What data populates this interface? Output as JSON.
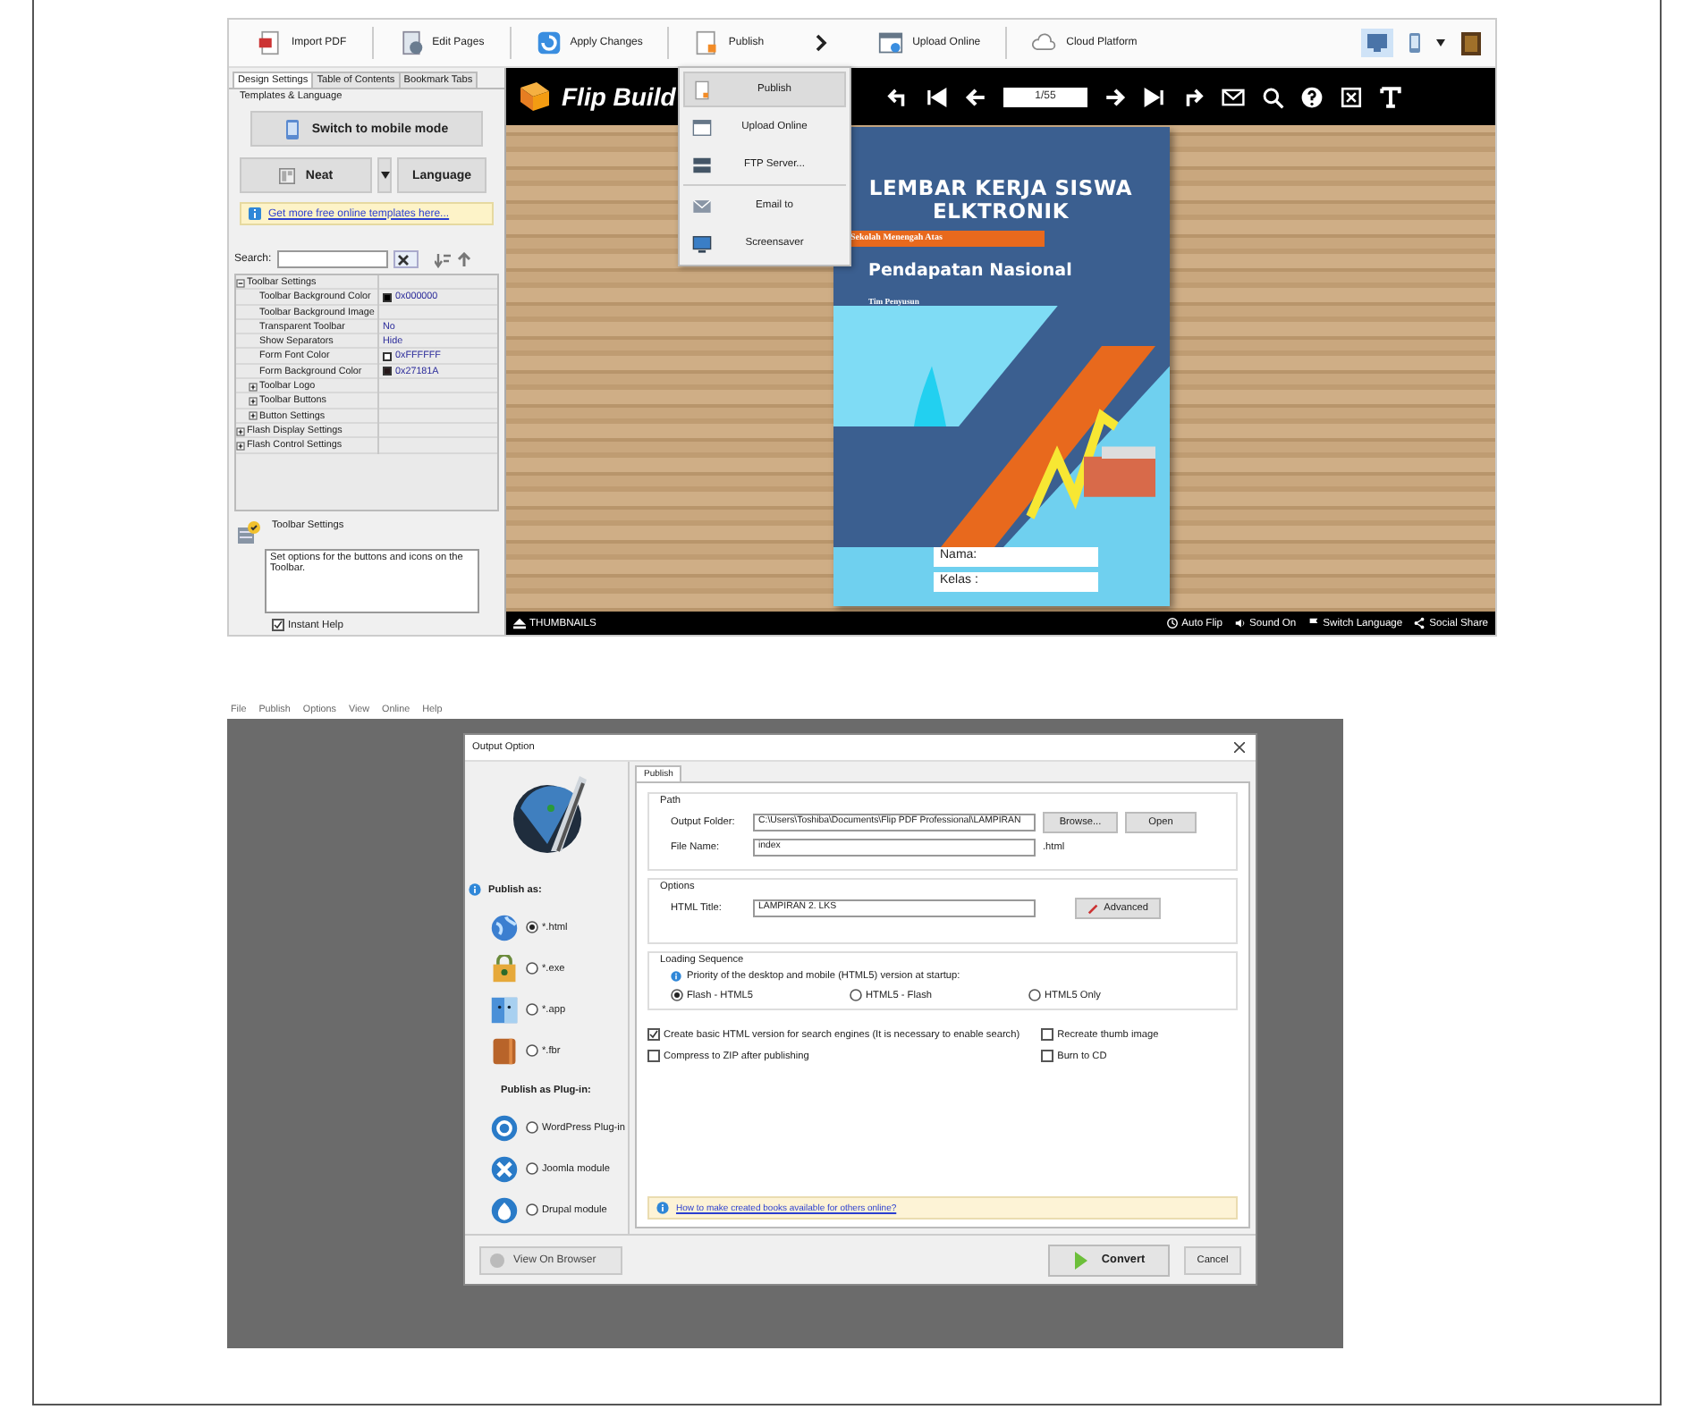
{
  "builder": {
    "toolbar": {
      "buttons": [
        {
          "label": "Import PDF",
          "kind": "pdf"
        },
        {
          "label": "Edit Pages",
          "kind": "pages"
        },
        {
          "label": "Apply Changes",
          "kind": "apply"
        },
        {
          "label": "Publish",
          "kind": "publish"
        },
        {
          "label": "Upload Online",
          "kind": "upload"
        },
        {
          "label": "Cloud Platform",
          "kind": "cloud"
        }
      ],
      "view_modes": [
        {
          "kind": "desktop",
          "selected": true
        },
        {
          "kind": "phone",
          "selected": false
        }
      ]
    },
    "sidebar": {
      "tabs": [
        {
          "label": "Design Settings",
          "selected": true
        },
        {
          "label": "Table of Contents",
          "selected": false
        },
        {
          "label": "Bookmark Tabs",
          "selected": false
        }
      ],
      "group_title": "Templates & Language",
      "mobile_button": "Switch to mobile mode",
      "template_button": "Neat",
      "language_button": "Language",
      "templates_link": "Get more free online templates here...",
      "search_label": "Search:",
      "tree": [
        {
          "label": "Toolbar Settings",
          "expanded": true,
          "children": [
            {
              "label": "Toolbar Background Color",
              "value": "0x000000",
              "color": "#000000"
            },
            {
              "label": "Toolbar Background Image"
            },
            {
              "label": "Transparent Toolbar",
              "value": "No"
            },
            {
              "label": "Show Separators",
              "value": "Hide"
            },
            {
              "label": "Form Font Color",
              "value": "0xFFFFFF",
              "color": "#ffffff"
            },
            {
              "label": "Form Background Color",
              "value": "0x27181A",
              "color": "#27181a"
            },
            {
              "label": "Toolbar Logo",
              "expanded": false
            },
            {
              "label": "Toolbar Buttons",
              "expanded": false
            },
            {
              "label": "Button Settings",
              "expanded": false
            }
          ]
        },
        {
          "label": "Flash Display Settings",
          "expanded": false
        },
        {
          "label": "Flash Control Settings",
          "expanded": false
        }
      ],
      "help": {
        "title": "Toolbar Settings",
        "text": "Set options for the buttons and icons on the Toolbar.",
        "instant_help": {
          "label": "Instant Help",
          "checked": true
        }
      }
    },
    "viewer": {
      "title": "Flip Build",
      "page": "1/55",
      "publish_menu": [
        {
          "label": "Publish",
          "kind": "publish",
          "selected": true
        },
        {
          "label": "Upload Online",
          "kind": "upload",
          "selected": false
        },
        {
          "label": "FTP Server...",
          "kind": "ftp",
          "selected": false
        },
        {
          "label": "Email to",
          "kind": "email",
          "selected": false
        },
        {
          "label": "Screensaver",
          "kind": "screensaver",
          "selected": false
        }
      ],
      "book": {
        "title": "LEMBAR  KERJA SISWA ELKTRONIK",
        "school": "Sekolah Menengah Atas",
        "subject": "Pendapatan Nasional",
        "author": "Tim Penyusun",
        "fields": [
          "Nama:",
          "Kelas :"
        ]
      },
      "bottom_bar": {
        "thumbnails": "THUMBNAILS",
        "items": [
          {
            "label": "Auto Flip",
            "kind": "autoflip"
          },
          {
            "label": "Sound On",
            "kind": "sound"
          },
          {
            "label": "Switch Language",
            "kind": "language"
          },
          {
            "label": "Social Share",
            "kind": "share"
          }
        ]
      }
    }
  },
  "publisher": {
    "menu": [
      "File",
      "Publish",
      "Options",
      "View",
      "Online",
      "Help"
    ],
    "dialog": {
      "title": "Output Option",
      "publish_as": "Publish as:",
      "formats": [
        {
          "label": "*.html",
          "kind": "html",
          "selected": true
        },
        {
          "label": "*.exe",
          "kind": "exe",
          "selected": false
        },
        {
          "label": "*.app",
          "kind": "app",
          "selected": false
        },
        {
          "label": "*.fbr",
          "kind": "fbr",
          "selected": false
        }
      ],
      "plugins_title": "Publish as Plug-in:",
      "plugins": [
        {
          "label": "WordPress Plug-in",
          "kind": "wordpress",
          "selected": false
        },
        {
          "label": "Joomla module",
          "kind": "joomla",
          "selected": false
        },
        {
          "label": "Drupal module",
          "kind": "drupal",
          "selected": false
        }
      ],
      "tab": "Publish",
      "path": {
        "title": "Path",
        "folder_label": "Output Folder:",
        "folder": "C:\\Users\\Toshiba\\Documents\\Flip PDF Professional\\LAMPIRAN",
        "browse": "Browse...",
        "open": "Open",
        "name_label": "File Name:",
        "name": "index",
        "extension": ".html"
      },
      "options": {
        "title": "Options",
        "html_title_label": "HTML Title:",
        "html_title": "LAMPIRAN 2. LKS",
        "advanced": "Advanced"
      },
      "loading": {
        "title": "Loading Sequence",
        "note": "Priority of the desktop and mobile (HTML5) version at startup:",
        "choices": [
          {
            "label": "Flash - HTML5",
            "selected": true
          },
          {
            "label": "HTML5 - Flash",
            "selected": false
          },
          {
            "label": "HTML5 Only",
            "selected": false
          }
        ]
      },
      "checkboxes": [
        {
          "label": "Create basic HTML version for search engines (It is necessary to enable search)",
          "checked": true
        },
        {
          "label": "Recreate thumb image",
          "checked": false
        },
        {
          "label": "Compress to ZIP after publishing",
          "checked": false
        },
        {
          "label": "Burn to CD",
          "checked": false
        }
      ],
      "help_link": "How to make created books available for others online?",
      "view_button": "View On Browser",
      "convert": "Convert",
      "cancel": "Cancel"
    }
  }
}
